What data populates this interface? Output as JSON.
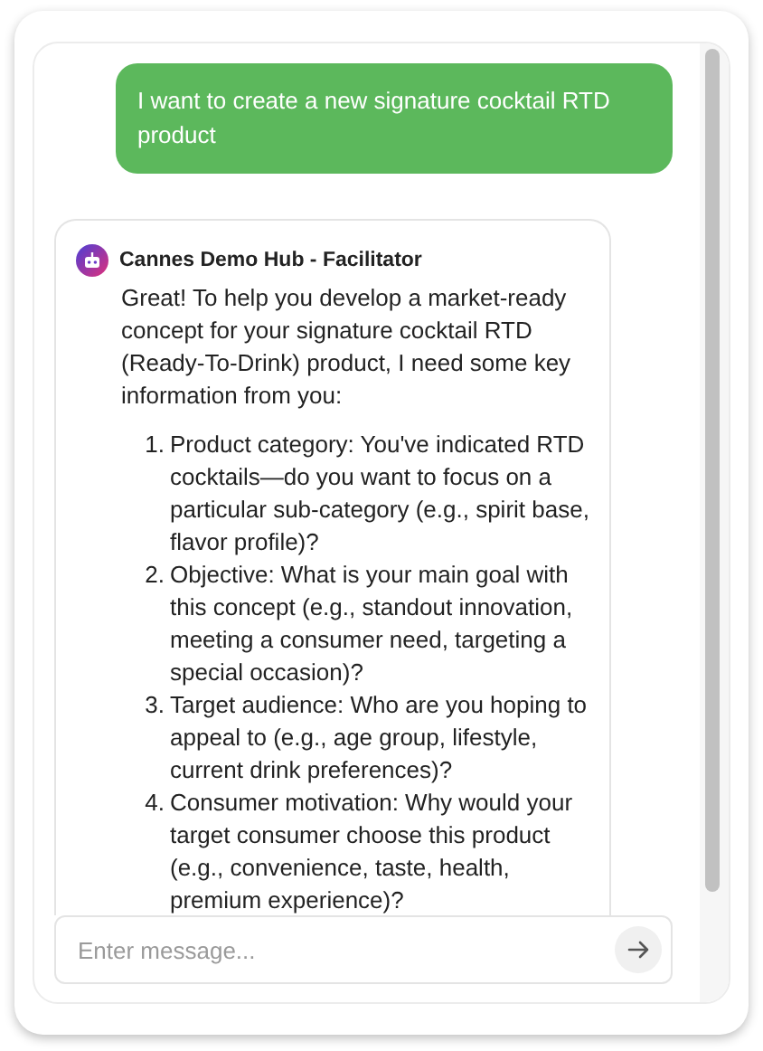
{
  "messages": [
    {
      "kind": "user",
      "text": "I want to create a new signature cocktail RTD product"
    },
    {
      "kind": "assistant",
      "sender": "Cannes Demo Hub - Facilitator",
      "intro": "Great! To help you develop a market-ready concept for your signature cocktail RTD (Ready-To-Drink) product, I need some key information from you:",
      "items": [
        {
          "number": "1.",
          "text": "Product category: You've indicated RTD cocktails—do you want to focus on a particular sub-category (e.g., spirit base, flavor profile)?"
        },
        {
          "number": "2.",
          "text": "Objective: What is your main goal with this concept (e.g., standout innovation, meeting a consumer need, targeting a special occasion)?"
        },
        {
          "number": "3.",
          "text": "Target audience: Who are you hoping to appeal to (e.g., age group, lifestyle, current drink preferences)?"
        },
        {
          "number": "4.",
          "text": "Consumer motivation: Why would your target consumer choose this product (e.g., convenience, taste, health, premium experience)?"
        }
      ]
    }
  ],
  "composer": {
    "placeholder": "Enter message..."
  }
}
